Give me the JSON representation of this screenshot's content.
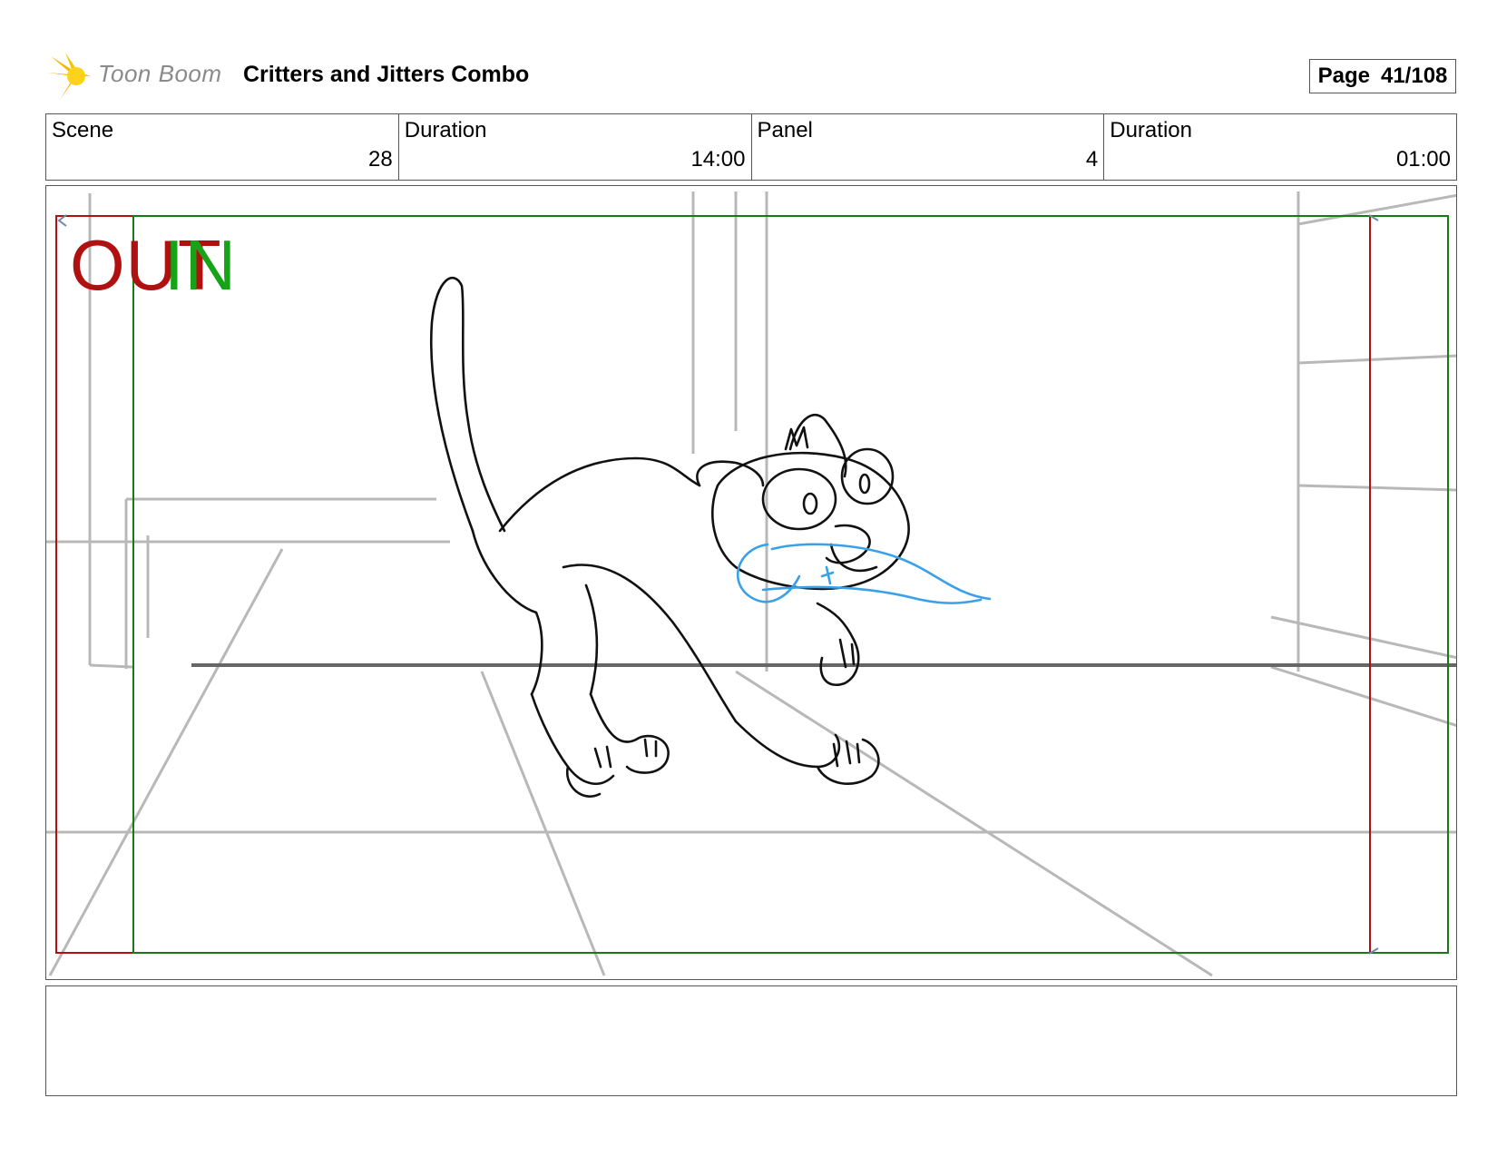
{
  "header": {
    "brand": "Toon Boom",
    "title": "Critters and Jitters Combo",
    "page_label": "Page",
    "page_value": "41/108"
  },
  "info": {
    "scene_label": "Scene",
    "scene_value": "28",
    "scene_duration_label": "Duration",
    "scene_duration_value": "14:00",
    "panel_label": "Panel",
    "panel_value": "4",
    "panel_duration_label": "Duration",
    "panel_duration_value": "01:00"
  },
  "panel": {
    "out_label": "OUT",
    "in_label": "IN",
    "colors": {
      "out_frame": "#b01010",
      "in_frame": "#167a16",
      "guides": "#b8b8b8",
      "ink": "#111111",
      "fx": "#3aa0e8"
    }
  },
  "notes": {
    "text": ""
  }
}
